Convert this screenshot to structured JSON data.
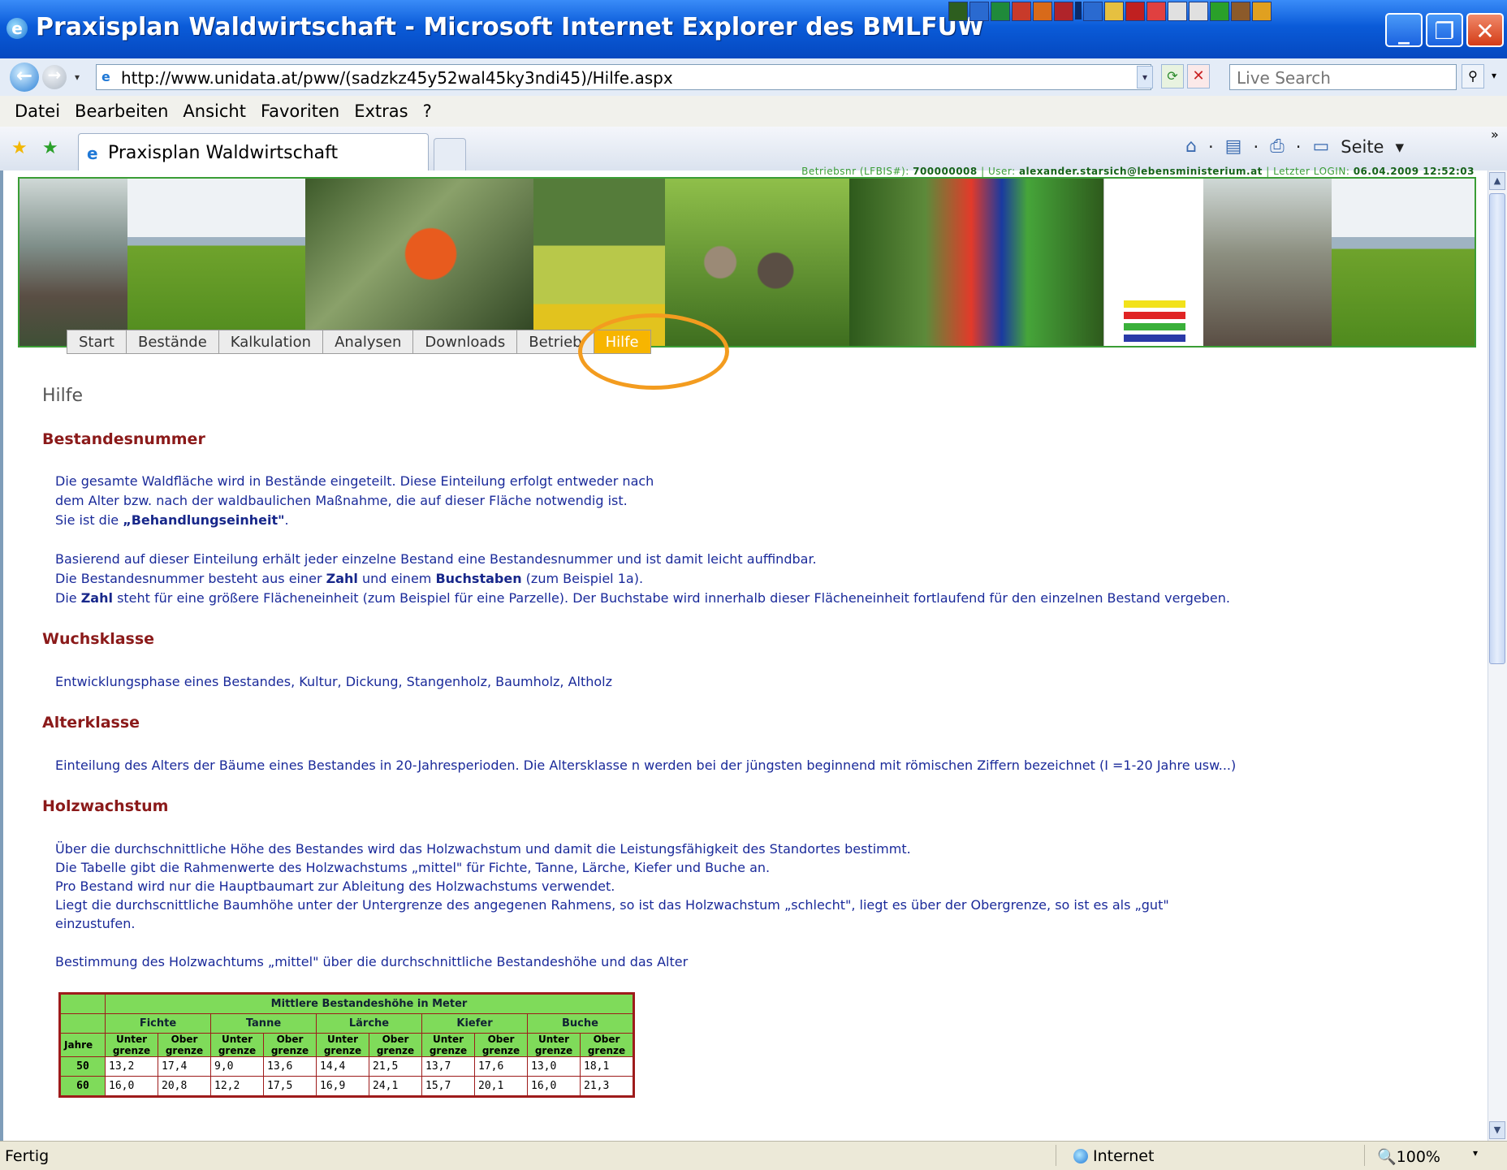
{
  "window": {
    "title": "Praxisplan Waldwirtschaft - Microsoft Internet Explorer des BMLFUW"
  },
  "addressbar": {
    "url": "http://www.unidata.at/pww/(sadzkz45y52wal45ky3ndi45)/Hilfe.aspx",
    "search_placeholder": "Live Search"
  },
  "menu": [
    "Datei",
    "Bearbeiten",
    "Ansicht",
    "Favoriten",
    "Extras",
    "?"
  ],
  "tab": {
    "title": "Praxisplan Waldwirtschaft"
  },
  "toolbar": {
    "seite": "Seite"
  },
  "userinfo": {
    "betriebsnr_label": "Betriebsnr (LFBIS#):",
    "betriebsnr": "700000008",
    "user_label": "User:",
    "user": "alexander.starsich@lebensministerium.at",
    "login_label": "Letzter LOGIN:",
    "login": "06.04.2009 12:52:03"
  },
  "nav": [
    "Start",
    "Bestände",
    "Kalkulation",
    "Analysen",
    "Downloads",
    "Betrieb",
    "Hilfe"
  ],
  "nav_active": "Hilfe",
  "page": {
    "title": "Hilfe",
    "sections": [
      {
        "heading": "Bestandesnummer",
        "lines": [
          "Die gesamte Waldfläche wird in Bestände eingeteilt. Diese Einteilung erfolgt entweder nach",
          "dem Alter bzw. nach der waldbaulichen Maßnahme, die auf dieser Fläche notwendig ist.",
          "Sie ist die „Behandlungseinheit\".",
          "",
          "Basierend auf dieser Einteilung erhält jeder einzelne Bestand eine Bestandesnummer und ist damit leicht auffindbar.",
          "Die Bestandesnummer besteht aus einer Zahl und einem Buchstaben (zum Beispiel 1a).",
          "Die Zahl steht für eine größere Flächeneinheit (zum Beispiel für eine Parzelle). Der Buchstabe wird innerhalb dieser Flächeneinheit fortlaufend für den einzelnen Bestand vergeben."
        ]
      },
      {
        "heading": "Wuchsklasse",
        "lines": [
          "Entwicklungsphase eines Bestandes, Kultur, Dickung, Stangenholz, Baumholz, Altholz"
        ]
      },
      {
        "heading": "Alterklasse",
        "lines": [
          "Einteilung des Alters der Bäume eines Bestandes in 20-Jahresperioden. Die Altersklasse n werden bei der jüngsten beginnend mit römischen Ziffern bezeichnet (I =1-20 Jahre usw...)"
        ]
      },
      {
        "heading": "Holzwachstum",
        "lines": [
          "Über die durchschnittliche Höhe des Bestandes wird das Holzwachstum und damit die Leistungsfähigkeit des Standortes bestimmt.",
          "Die Tabelle gibt die Rahmenwerte des Holzwachstums „mittel\" für Fichte, Tanne, Lärche, Kiefer und Buche an.",
          "Pro Bestand wird nur die Hauptbaumart zur Ableitung des Holzwachstums verwendet.",
          "Liegt die durchscnittliche Baumhöhe unter der Untergrenze des angegenen Rahmens, so ist das Holzwachstum „schlecht\", liegt es über der Obergrenze, so ist es als „gut\"",
          "einzustufen.",
          "",
          "Bestimmung des Holzwachtums „mittel\" über die durchschnittliche Bestandeshöhe und das Alter"
        ]
      }
    ]
  },
  "table": {
    "caption": "Mittlere Bestandeshöhe in Meter",
    "year_header": "Jahre",
    "species": [
      "Fichte",
      "Tanne",
      "Lärche",
      "Kiefer",
      "Buche"
    ],
    "sub_lower": "Unter grenze",
    "sub_upper": "Ober grenze",
    "rows": [
      {
        "year": "50",
        "values": [
          "13,2",
          "17,4",
          "9,0",
          "13,6",
          "14,4",
          "21,5",
          "13,7",
          "17,6",
          "13,0",
          "18,1"
        ]
      },
      {
        "year": "60",
        "values": [
          "16,0",
          "20,8",
          "12,2",
          "17,5",
          "16,9",
          "24,1",
          "15,7",
          "20,1",
          "16,0",
          "21,3"
        ]
      }
    ]
  },
  "status": {
    "text": "Fertig",
    "zone": "Internet",
    "zoom": "100%"
  }
}
